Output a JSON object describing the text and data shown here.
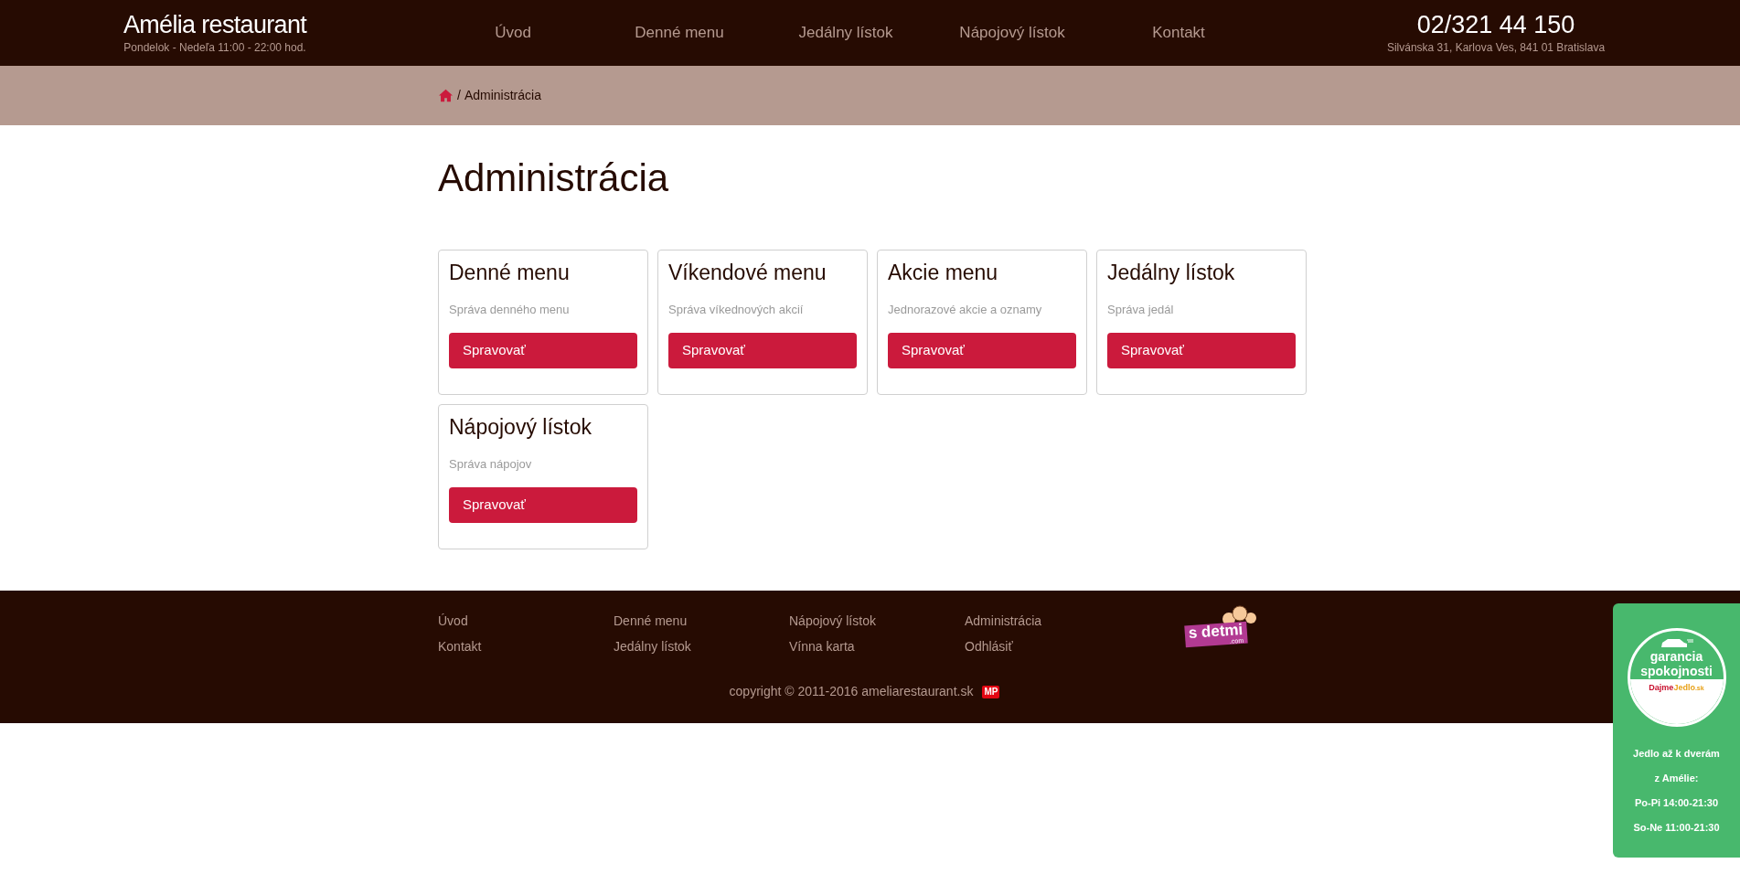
{
  "header": {
    "brand": "Amélia restaurant",
    "hours": "Pondelok - Nedeľa 11:00 - 22:00 hod.",
    "nav": [
      {
        "label": "Úvod",
        "selected": false
      },
      {
        "label": "Denné menu",
        "selected": false
      },
      {
        "label": "Jedálny lístok",
        "selected": false
      },
      {
        "label": "Nápojový lístok",
        "selected": false
      },
      {
        "label": "Kontakt",
        "selected": false
      }
    ],
    "phone": "02/321 44 150",
    "address": "Silvánska 31, Karlova Ves, 841 01 Bratislava"
  },
  "breadcrumb": {
    "separator": "/",
    "current": "Administrácia"
  },
  "page_title": "Administrácia",
  "cards": [
    {
      "title": "Denné menu",
      "description": "Správa denného menu",
      "button": "Spravovať"
    },
    {
      "title": "Víkendové menu",
      "description": "Správa víkednových akcií",
      "button": "Spravovať"
    },
    {
      "title": "Akcie menu",
      "description": "Jednorazové akcie a oznamy",
      "button": "Spravovať"
    },
    {
      "title": "Jedálny lístok",
      "description": "Správa jedál",
      "button": "Spravovať"
    },
    {
      "title": "Nápojový lístok",
      "description": "Správa nápojov",
      "button": "Spravovať"
    }
  ],
  "footer": {
    "columns": [
      [
        "Úvod",
        "Kontakt"
      ],
      [
        "Denné menu",
        "Jedálny lístok"
      ],
      [
        "Nápojový lístok",
        "Vínna karta"
      ],
      [
        "Administrácia",
        "Odhlásiť"
      ]
    ],
    "logo": {
      "main": "s detmi",
      "sub": ".com"
    },
    "copyright": "copyright © 2011-2016 ameliarestaurant.sk",
    "badge": "MP"
  },
  "delivery_widget": {
    "badge_line_1": "garancia",
    "badge_line_2": "spokojnosti",
    "partner_1": "Dajme",
    "partner_2": "Jedlo",
    "partner_3": ".sk",
    "lines": [
      "Jedlo až k dverám",
      "z Amélie:",
      "Po-Pi 14:00-21:30",
      "So-Ne 11:00-21:30"
    ]
  }
}
